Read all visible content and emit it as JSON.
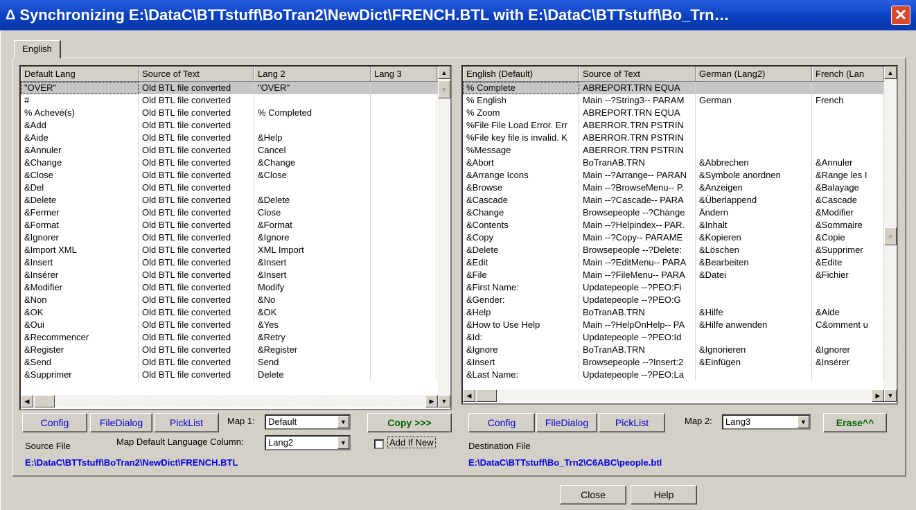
{
  "window": {
    "title": "Synchronizing E:\\DataC\\BTTstuff\\BoTran2\\NewDict\\FRENCH.BTL with E:\\DataC\\BTTstuff\\Bo_Trn…",
    "delta_glyph": "Δ",
    "close_glyph": "✕"
  },
  "tabs": [
    "English"
  ],
  "left": {
    "headers": [
      "Default Lang",
      "Source of Text",
      "Lang 2",
      "Lang 3"
    ],
    "rows": [
      [
        "\"OVER\"",
        "Old BTL file converted",
        "\"OVER\"",
        ""
      ],
      [
        "#",
        "Old BTL file converted",
        "",
        ""
      ],
      [
        "% Achevé(s)",
        "Old BTL file converted",
        "% Completed",
        ""
      ],
      [
        "&Add",
        "Old BTL file converted",
        "",
        ""
      ],
      [
        "&Aide",
        "Old BTL file converted",
        "&Help",
        ""
      ],
      [
        "&Annuler",
        "Old BTL file converted",
        "Cancel",
        ""
      ],
      [
        "&Change",
        "Old BTL file converted",
        "&Change",
        ""
      ],
      [
        "&Close",
        "Old BTL file converted",
        "&Close",
        ""
      ],
      [
        "&Del",
        "Old BTL file converted",
        "",
        ""
      ],
      [
        "&Delete",
        "Old BTL file converted",
        "&Delete",
        ""
      ],
      [
        "&Fermer",
        "Old BTL file converted",
        "Close",
        ""
      ],
      [
        "&Format",
        "Old BTL file converted",
        "&Format",
        ""
      ],
      [
        "&Ignorer",
        "Old BTL file converted",
        "&Ignore",
        ""
      ],
      [
        "&Import XML",
        "Old BTL file converted",
        "XML Import",
        ""
      ],
      [
        "&Insert",
        "Old BTL file converted",
        "&Insert",
        ""
      ],
      [
        "&Insérer",
        "Old BTL file converted",
        "&Insert",
        ""
      ],
      [
        "&Modifier",
        "Old BTL file converted",
        "Modify",
        ""
      ],
      [
        "&Non",
        "Old BTL file converted",
        "&No",
        ""
      ],
      [
        "&OK",
        "Old BTL file converted",
        "&OK",
        ""
      ],
      [
        "&Oui",
        "Old BTL file converted",
        "&Yes",
        ""
      ],
      [
        "&Recommencer",
        "Old BTL file converted",
        "&Retry",
        ""
      ],
      [
        "&Register",
        "Old BTL file converted",
        "&Register",
        ""
      ],
      [
        "&Send",
        "Old BTL file converted",
        "Send",
        ""
      ],
      [
        "&Supprimer",
        "Old BTL file converted",
        "Delete",
        ""
      ]
    ],
    "config_label": "Config",
    "filedialog_label": "FileDialog",
    "picklist_label": "PickList",
    "map_label": "Map 1:",
    "map_value": "Default",
    "copy_label": "Copy >>>",
    "source_file_label": "Source File",
    "map_default_label": "Map Default Language Column:",
    "map_default_value": "Lang2",
    "add_if_new_label": "Add If New",
    "source_path": "E:\\DataC\\BTTstuff\\BoTran2\\NewDict\\FRENCH.BTL"
  },
  "right": {
    "headers": [
      "English (Default)",
      "Source of Text",
      "German (Lang2)",
      "French (Lan"
    ],
    "rows": [
      [
        "% Complete",
        "ABREPORT.TRN EQUA",
        "",
        ""
      ],
      [
        "% English",
        "Main --?String3-- PARAM",
        "German",
        "French"
      ],
      [
        "% Zoom",
        "ABREPORT.TRN EQUA",
        "",
        ""
      ],
      [
        "%File File Load Error.  Err",
        "ABERROR.TRN PSTRIN",
        "",
        ""
      ],
      [
        "%File key file is invalid. K",
        "ABERROR.TRN PSTRIN",
        "",
        ""
      ],
      [
        "%Message",
        "ABERROR.TRN PSTRIN",
        "",
        ""
      ],
      [
        "&Abort",
        "BoTranAB.TRN",
        "&Abbrechen",
        "&Annuler"
      ],
      [
        "&Arrange Icons",
        "Main --?Arrange-- PARAN",
        "&Symbole anordnen",
        "&Range les I"
      ],
      [
        "&Browse",
        "Main --?BrowseMenu-- P.",
        "&Anzeigen",
        "&Balayage"
      ],
      [
        "&Cascade",
        "Main --?Cascade-- PARA",
        "&Überlappend",
        "&Cascade"
      ],
      [
        "&Change",
        "Browsepeople --?Change",
        "Ändern",
        "&Modifier"
      ],
      [
        "&Contents",
        "Main --?Helpindex-- PAR.",
        "&Inhalt",
        "&Sommaire"
      ],
      [
        "&Copy",
        "Main --?Copy-- PARAME",
        "&Kopieren",
        "&Copie"
      ],
      [
        "&Delete",
        "Browsepeople --?Delete:",
        "&Löschen",
        "&Supprimer"
      ],
      [
        "&Edit",
        "Main --?EditMenu-- PARA",
        "&Bearbeiten",
        "&Edite"
      ],
      [
        "&File",
        "Main --?FileMenu-- PARA",
        "&Datei",
        "&Fichier"
      ],
      [
        "&First Name:",
        "Updatepeople --?PEO:Fi",
        "",
        ""
      ],
      [
        "&Gender:",
        "Updatepeople --?PEO:G",
        "",
        ""
      ],
      [
        "&Help",
        "BoTranAB.TRN",
        "&Hilfe",
        "&Aide"
      ],
      [
        "&How to Use Help",
        "Main --?HelpOnHelp-- PA",
        "&Hilfe anwenden",
        "C&omment u"
      ],
      [
        "&Id:",
        "Updatepeople --?PEO:Id",
        "",
        ""
      ],
      [
        "&Ignore",
        "BoTranAB.TRN",
        "&Ignorieren",
        "&Ignorer"
      ],
      [
        "&Insert",
        "Browsepeople --?Insert:2",
        "&Einfügen",
        "&Insérer"
      ],
      [
        "&Last Name:",
        "Updatepeople --?PEO:La",
        "",
        ""
      ]
    ],
    "config_label": "Config",
    "filedialog_label": "FileDialog",
    "picklist_label": "PickList",
    "map_label": "Map 2:",
    "map_value": "Lang3",
    "erase_label": "Erase^^",
    "dest_file_label": "Destination File",
    "dest_path": "E:\\DataC\\BTTstuff\\Bo_Trn2\\C6ABC\\people.btl"
  },
  "footer": {
    "close_label": "Close",
    "help_label": "Help"
  },
  "icons": {
    "up": "▲",
    "down": "▼",
    "left": "◀",
    "right": "▶",
    "grip": "≡"
  }
}
